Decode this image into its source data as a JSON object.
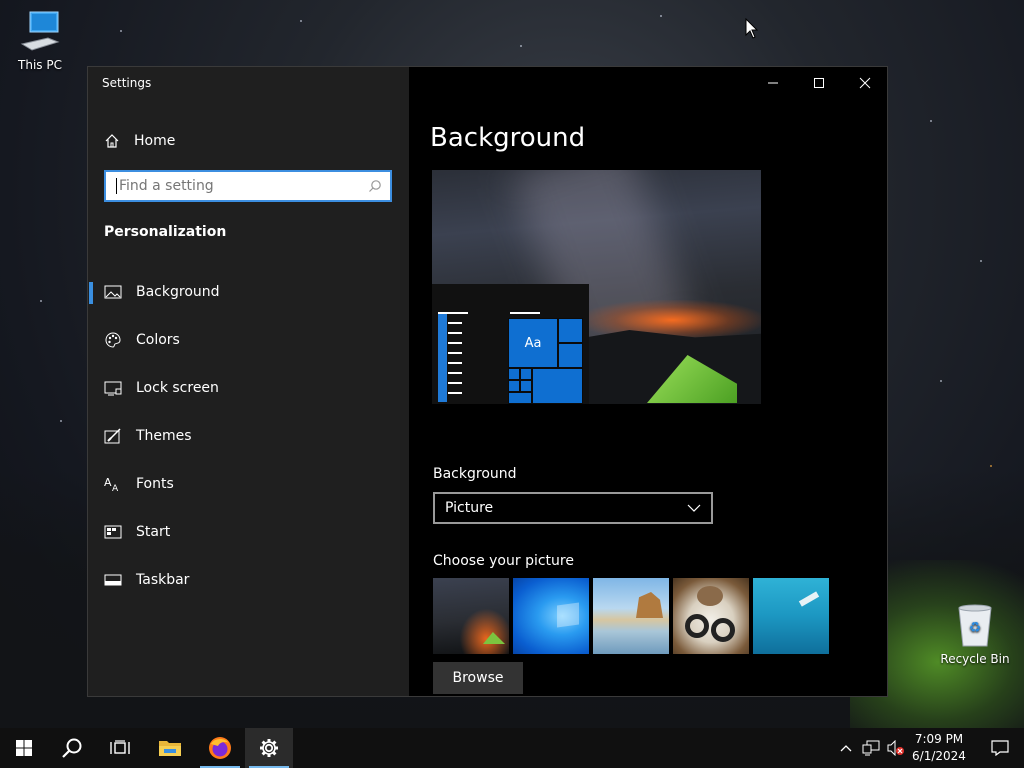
{
  "desktop": {
    "icons": [
      {
        "label": "This PC",
        "icon": "this-pc-icon"
      },
      {
        "label": "Recycle Bin",
        "icon": "recycle-bin-icon"
      }
    ]
  },
  "window": {
    "title": "Settings",
    "controls": {
      "minimize": "minimize-icon",
      "maximize": "maximize-icon",
      "close": "close-icon"
    }
  },
  "sidebar": {
    "home_label": "Home",
    "search": {
      "placeholder": "Find a setting",
      "value": ""
    },
    "section_title": "Personalization",
    "items": [
      {
        "label": "Background",
        "icon": "picture-icon",
        "selected": true
      },
      {
        "label": "Colors",
        "icon": "palette-icon",
        "selected": false
      },
      {
        "label": "Lock screen",
        "icon": "lock-screen-icon",
        "selected": false
      },
      {
        "label": "Themes",
        "icon": "themes-icon",
        "selected": false
      },
      {
        "label": "Fonts",
        "icon": "fonts-icon",
        "selected": false
      },
      {
        "label": "Start",
        "icon": "start-icon",
        "selected": false
      },
      {
        "label": "Taskbar",
        "icon": "taskbar-icon",
        "selected": false
      }
    ]
  },
  "content": {
    "page_title": "Background",
    "preview": {
      "tile_text": "Aa"
    },
    "background_label": "Background",
    "background_select": {
      "value": "Picture"
    },
    "choose_label": "Choose your picture",
    "thumbnails": [
      "milky-way-tent",
      "windows-blue",
      "beach-rocks",
      "cat-shoes",
      "underwater-swimmer"
    ],
    "browse_label": "Browse"
  },
  "taskbar": {
    "buttons": [
      "start-icon",
      "search-icon",
      "task-view-icon",
      "file-explorer-icon",
      "firefox-icon",
      "settings-icon"
    ],
    "active": "settings-icon",
    "tray": {
      "time": "7:09 PM",
      "date": "6/1/2024"
    }
  },
  "colors": {
    "accent": "#3a8fe0",
    "tile": "#0f6fd1",
    "sidebar_bg": "#1f1f1f",
    "content_bg": "#000000",
    "taskbar_bg": "#101010"
  }
}
